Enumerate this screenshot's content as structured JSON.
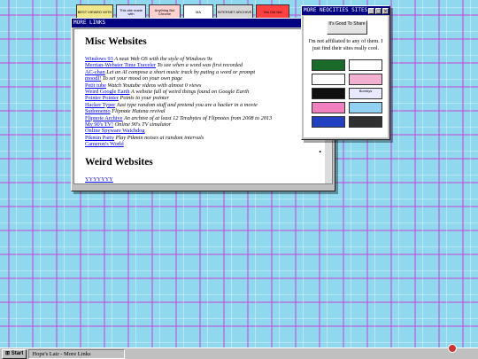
{
  "badges": [
    {
      "text": "BEST VIEWED WITH",
      "bg": "#f0e68c",
      "w": 40
    },
    {
      "text": "This site made with",
      "bg": "#e0e0ff",
      "w": 32
    },
    {
      "text": "Anything But Chrome",
      "bg": "#ffd0d0",
      "w": 34
    },
    {
      "text": "MA",
      "bg": "#ffffff",
      "w": 32
    },
    {
      "text": "INTERNET ARCHIVE",
      "bg": "#d8d8d8",
      "w": 40
    },
    {
      "text": "Yes Old Net",
      "bg": "#ff4040",
      "w": 36
    }
  ],
  "main_window": {
    "title": "MORE LINKS",
    "section1_heading": "Misc Websites",
    "links": [
      {
        "name": "Windows 93",
        "desc": "A neat Web OS with the style of Windows 9x"
      },
      {
        "name": "Merrian-Webster Time Traveler",
        "desc": "To see when a word was first recorded"
      },
      {
        "name": "AC-chan",
        "desc": "Let an AI compose a short music track by puting a word or prompt"
      },
      {
        "name": "moodl!",
        "desc": "To set your mood on your own page"
      },
      {
        "name": "Petit tube",
        "desc": "Watch Youtube videos with almost 0 views"
      },
      {
        "name": "Weird Google Earth",
        "desc": "A website full of weird things found on Google Earth"
      },
      {
        "name": "Pointer Pointer",
        "desc": "Points to your pointer"
      },
      {
        "name": "Hacker Typer",
        "desc": "Just type random stuff and pretend you are a hacker in a movie"
      },
      {
        "name": "Sudomemo",
        "desc": "Flipnote Hatena revival"
      },
      {
        "name": "Flipnote Archive",
        "desc": "An archive of at least 12 Terabytes of Flipnotes from 2008 to 2013"
      },
      {
        "name": "My 90's TV!",
        "desc": "Online 90's TV simulator"
      },
      {
        "name": "Online Spyware Watchdog",
        "desc": ""
      },
      {
        "name": "Pikmin Party",
        "desc": "Play Pikmin noises at random intervals"
      },
      {
        "name": "Cameron's World",
        "desc": ""
      }
    ],
    "section2_heading": "Weird Websites",
    "section2_first": "YYYYYYY"
  },
  "neo_window": {
    "title": "MORE NEOCITIES SITES",
    "good_button": "It's Good To Share",
    "note": "I'm not affiliated to any of them. I just find their sites really cool.",
    "sites": [
      {
        "text": "",
        "bg": "#1a6a2a"
      },
      {
        "text": "",
        "bg": "#ffffff"
      },
      {
        "text": "",
        "bg": "#ffffff"
      },
      {
        "text": "",
        "bg": "#f4b0d0"
      },
      {
        "text": "",
        "bg": "#101010"
      },
      {
        "text": "Bombys",
        "bg": "#e8e8ff"
      },
      {
        "text": "",
        "bg": "#f080c0"
      },
      {
        "text": "",
        "bg": "#90d0f0"
      },
      {
        "text": "",
        "bg": "#2040c0"
      },
      {
        "text": "",
        "bg": "#303030"
      }
    ]
  },
  "taskbar": {
    "start_label": "Start",
    "task_label": "Hope's Lair - More Links"
  }
}
